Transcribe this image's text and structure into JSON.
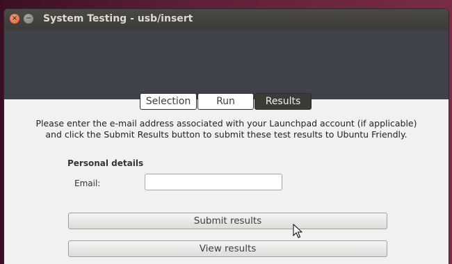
{
  "window": {
    "title": "System Testing - usb/insert"
  },
  "tabs": [
    {
      "label": "Selection",
      "active": false
    },
    {
      "label": "Run",
      "active": false
    },
    {
      "label": "Results",
      "active": true
    }
  ],
  "results": {
    "intro_line1": "Please enter the e-mail address associated with your Launchpad account (if applicable)",
    "intro_line2": "and click the Submit Results button to submit these test results to Ubuntu Friendly.",
    "section_label": "Personal details",
    "email_label": "Email:",
    "email_value": "",
    "submit_label": "Submit results",
    "view_label": "View results"
  },
  "colors": {
    "banner": "#3f4249",
    "active_tab": "#3c3b37",
    "close_button": "#e8572a"
  },
  "icons": [
    "close-icon",
    "minimize-icon",
    "mouse-pointer-icon"
  ]
}
